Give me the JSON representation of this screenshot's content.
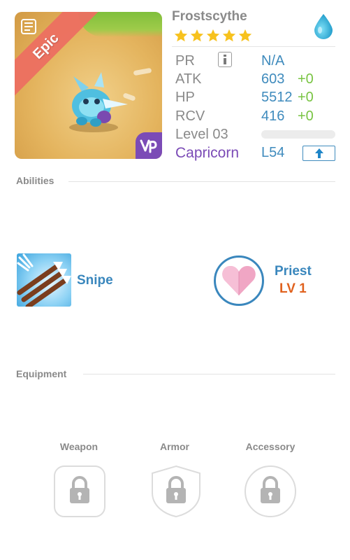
{
  "hero": {
    "name": "Frostscythe",
    "rarity": "Epic",
    "star_count": 5,
    "element_icon": "water-drop-icon",
    "element_color": "#3fb6de"
  },
  "stats": {
    "pr": {
      "label": "PR",
      "value": "N/A"
    },
    "atk": {
      "label": "ATK",
      "value": "603",
      "bonus": "+0"
    },
    "hp": {
      "label": "HP",
      "value": "5512",
      "bonus": "+0"
    },
    "rcv": {
      "label": "RCV",
      "value": "416",
      "bonus": "+0"
    },
    "level": {
      "label": "Level 03",
      "progress": 0
    },
    "sign": {
      "label": "Capricorn",
      "level": "L54"
    }
  },
  "abilities": {
    "title": "Abilities",
    "skill": {
      "name": "Snipe",
      "icon": "arrows-icon"
    },
    "class": {
      "name": "Priest",
      "level": "LV 1",
      "icon": "heart-icon"
    }
  },
  "equipment": {
    "title": "Equipment",
    "slots": [
      {
        "label": "Weapon",
        "state": "locked"
      },
      {
        "label": "Armor",
        "state": "locked"
      },
      {
        "label": "Accessory",
        "state": "locked"
      }
    ]
  },
  "colors": {
    "accent_blue": "#3f8bbd",
    "bonus_green": "#79c443",
    "sign_purple": "#7b4bb6",
    "rarity_red": "#ec6f61",
    "star_gold": "#f7c21e",
    "class_level_orange": "#e0621f"
  }
}
